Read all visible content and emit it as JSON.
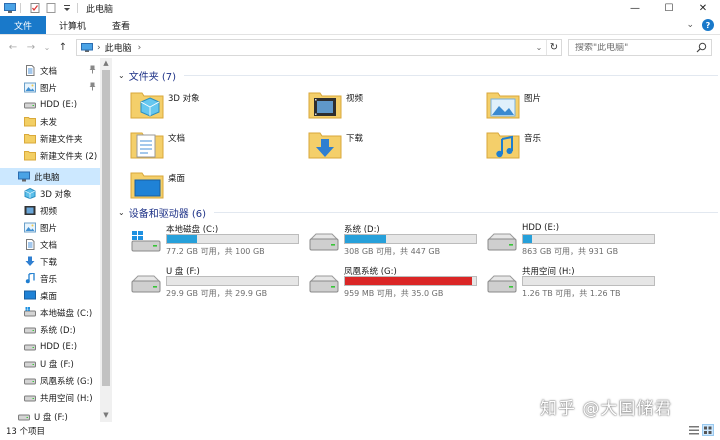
{
  "window": {
    "title": "此电脑",
    "minimize": "—",
    "maximize": "☐",
    "close": "✕"
  },
  "ribbon": {
    "tabs": [
      "文件",
      "计算机",
      "查看"
    ],
    "expand": "⌄",
    "help": "?"
  },
  "address": {
    "back": "←",
    "forward": "→",
    "recent": "⌄",
    "up": "↑",
    "path": "此电脑",
    "chevron": "›",
    "dropdown": "⌄",
    "refresh": "↻"
  },
  "search": {
    "placeholder": "搜索\"此电脑\""
  },
  "sidebar": {
    "items": [
      {
        "label": "文档",
        "icon": "document-icon",
        "pinned": true
      },
      {
        "label": "图片",
        "icon": "pictures-icon",
        "pinned": true
      },
      {
        "label": "HDD (E:)",
        "icon": "drive-icon",
        "pinned": false
      },
      {
        "label": "未发",
        "icon": "folder-icon",
        "pinned": false
      },
      {
        "label": "新建文件夹",
        "icon": "folder-icon",
        "pinned": false
      },
      {
        "label": "新建文件夹 (2)",
        "icon": "folder-icon",
        "pinned": false
      },
      {
        "label": "此电脑",
        "icon": "computer-icon",
        "pinned": false,
        "selected": true
      },
      {
        "label": "3D 对象",
        "icon": "3d-objects-icon",
        "pinned": false
      },
      {
        "label": "视频",
        "icon": "video-icon",
        "pinned": false
      },
      {
        "label": "图片",
        "icon": "pictures-icon",
        "pinned": false
      },
      {
        "label": "文档",
        "icon": "document-icon",
        "pinned": false
      },
      {
        "label": "下载",
        "icon": "download-icon",
        "pinned": false
      },
      {
        "label": "音乐",
        "icon": "music-icon",
        "pinned": false
      },
      {
        "label": "桌面",
        "icon": "desktop-icon",
        "pinned": false
      },
      {
        "label": "本地磁盘 (C:)",
        "icon": "windows-drive-icon",
        "pinned": false
      },
      {
        "label": "系统 (D:)",
        "icon": "drive-icon",
        "pinned": false
      },
      {
        "label": "HDD (E:)",
        "icon": "drive-icon",
        "pinned": false
      },
      {
        "label": "U 盘 (F:)",
        "icon": "drive-icon",
        "pinned": false
      },
      {
        "label": "凤凰系统 (G:)",
        "icon": "drive-icon",
        "pinned": false
      },
      {
        "label": "共用空间 (H:)",
        "icon": "drive-icon",
        "pinned": false
      },
      {
        "label": "U 盘 (F:)",
        "icon": "drive-icon",
        "pinned": false
      }
    ],
    "pin_glyph": "📌",
    "scroll_up": "▲",
    "scroll_down": "▼"
  },
  "folders": {
    "header": "文件夹 (7)",
    "items": [
      {
        "label": "3D 对象",
        "icon": "3d-objects-folder-icon"
      },
      {
        "label": "视频",
        "icon": "video-folder-icon"
      },
      {
        "label": "图片",
        "icon": "pictures-folder-icon"
      },
      {
        "label": "文档",
        "icon": "documents-folder-icon"
      },
      {
        "label": "下载",
        "icon": "downloads-folder-icon"
      },
      {
        "label": "音乐",
        "icon": "music-folder-icon"
      },
      {
        "label": "桌面",
        "icon": "desktop-folder-icon"
      }
    ]
  },
  "drives": {
    "header": "设备和驱动器 (6)",
    "items": [
      {
        "name": "本地磁盘 (C:)",
        "info": "77.2 GB 可用，共 100 GB",
        "used_fraction": 0.23,
        "critical": false,
        "icon": "windows-drive-icon"
      },
      {
        "name": "系统 (D:)",
        "info": "308 GB 可用，共 447 GB",
        "used_fraction": 0.31,
        "critical": false,
        "icon": "drive-icon"
      },
      {
        "name": "HDD (E:)",
        "info": "863 GB 可用，共 931 GB",
        "used_fraction": 0.07,
        "critical": false,
        "icon": "drive-icon"
      },
      {
        "name": "U 盘 (F:)",
        "info": "29.9 GB 可用，共 29.9 GB",
        "used_fraction": 0.0,
        "critical": false,
        "icon": "drive-icon"
      },
      {
        "name": "凤凰系统 (G:)",
        "info": "959 MB 可用，共 35.0 GB",
        "used_fraction": 0.97,
        "critical": true,
        "icon": "drive-icon"
      },
      {
        "name": "共用空间 (H:)",
        "info": "1.26 TB 可用，共 1.26 TB",
        "used_fraction": 0.0,
        "critical": false,
        "icon": "drive-icon"
      }
    ]
  },
  "status": {
    "count": "13 个项目"
  },
  "watermark": "知乎 @大国储君",
  "colors": {
    "accent": "#1979ca",
    "header_text": "#1e3287",
    "bar_fill": "#26a0da",
    "bar_critical": "#da2626",
    "selected": "#cce8ff"
  }
}
